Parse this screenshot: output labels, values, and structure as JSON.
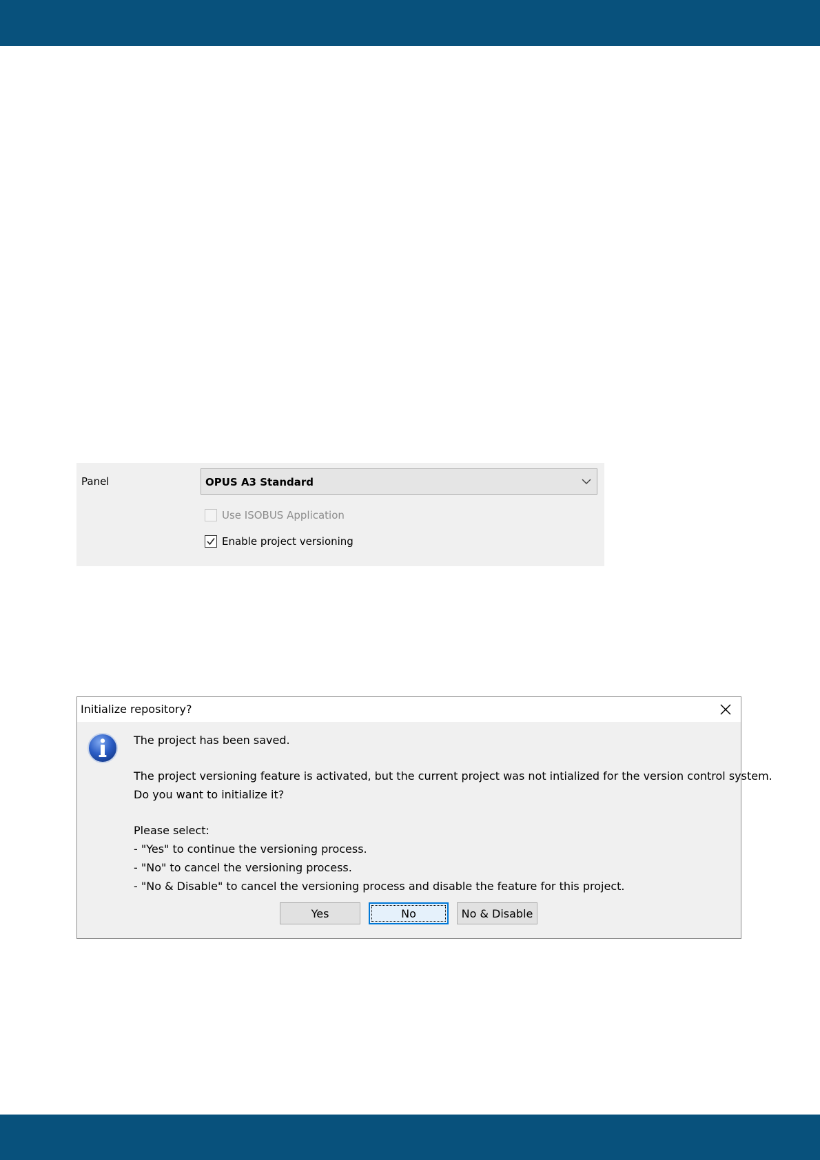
{
  "colors": {
    "header_band": "#08517c",
    "footer_band": "#08517c",
    "button_focus": "#0078d7",
    "info_icon": "#1e4fb0"
  },
  "settings": {
    "panel_label": "Panel",
    "panel_select_value": "OPUS A3 Standard",
    "use_isobus": {
      "label": "Use ISOBUS Application",
      "checked": false,
      "disabled": true
    },
    "enable_versioning": {
      "label": "Enable project versioning",
      "checked": true,
      "disabled": false
    }
  },
  "dialog": {
    "title": "Initialize repository?",
    "icon": "info-icon",
    "lines": [
      "The project has been saved.",
      "The project versioning feature is activated, but the current project was not intialized for the version control system.",
      "Do you want to initialize it?",
      "Please select:",
      "- \"Yes\" to continue the versioning process.",
      "- \"No\" to cancel the versioning process.",
      "- \"No & Disable\" to cancel the versioning process and disable the feature for this project."
    ],
    "buttons": {
      "yes": "Yes",
      "no": "No",
      "no_disable": "No & Disable"
    }
  }
}
